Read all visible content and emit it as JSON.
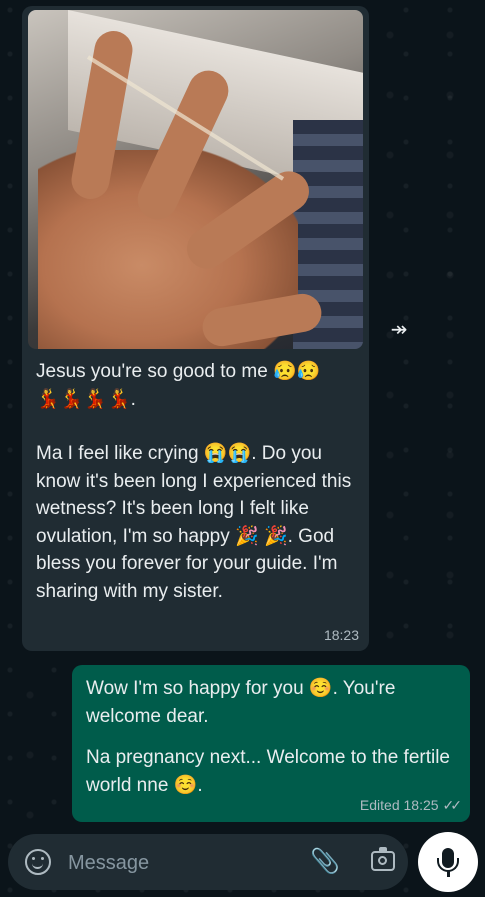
{
  "incoming": {
    "line1": "Jesus you're so good to me 😥😥",
    "line2": "💃💃💃💃.",
    "para2": "Ma I feel like crying 😭😭. Do you know it's been long I experienced this wetness? It's been long I felt like ovulation, I'm so happy 🎉 🎉. God bless you forever for your guide. I'm sharing with my sister.",
    "time": "18:23",
    "forward_icon": "forward-icon"
  },
  "outgoing": {
    "para1": "Wow I'm so happy for you ☺️. You're welcome dear.",
    "para2": "Na pregnancy next... Welcome to the fertile world nne ☺️.",
    "edited_time": "Edited 18:25",
    "ticks": "✓✓"
  },
  "composer": {
    "placeholder": "Message",
    "attach_glyph": "📎"
  },
  "colors": {
    "background": "#0b141a",
    "incoming_bubble": "#202c33",
    "outgoing_bubble": "#005c4b",
    "meta_text": "#aebac1"
  }
}
